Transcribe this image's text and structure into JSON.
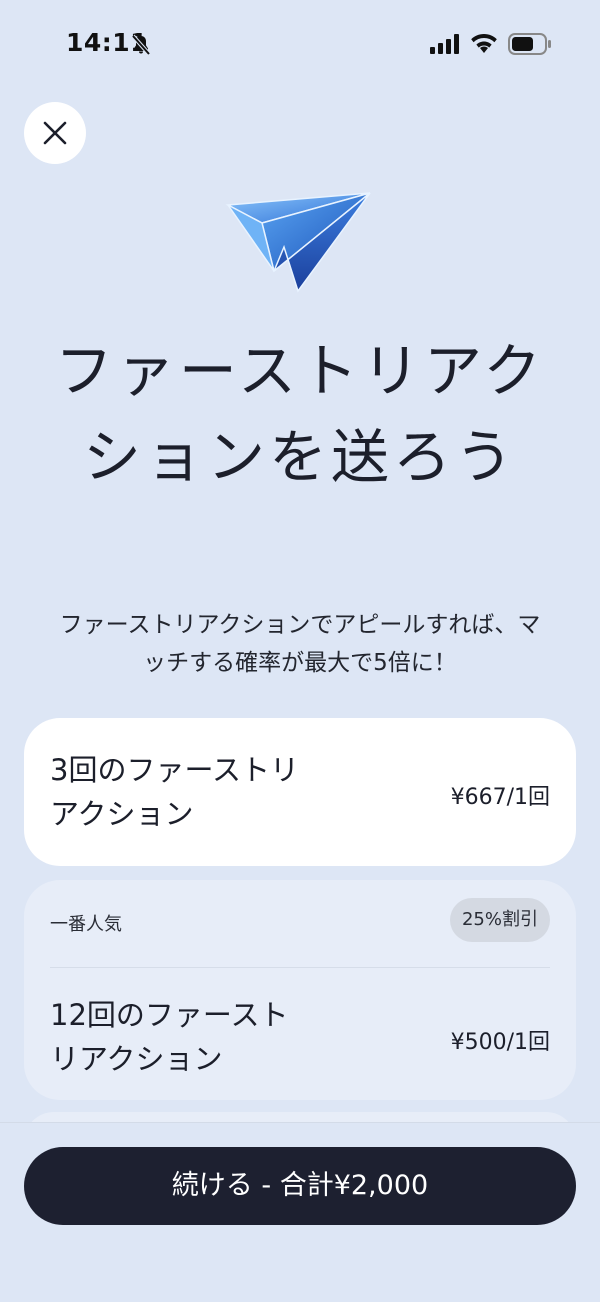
{
  "status_bar": {
    "time": "14:11",
    "icons": [
      "bell-slash-icon",
      "cellular-signal-icon",
      "wifi-icon",
      "battery-icon"
    ]
  },
  "header": {
    "close_icon": "close-icon",
    "hero_icon": "paper-plane-icon"
  },
  "main": {
    "title": "ファーストリアクションを送ろう",
    "subtitle": "ファーストリアクションでアピールすれば、マッチする確率が最大で5倍に！"
  },
  "options": [
    {
      "name": "3回のファーストリアクション",
      "price": "¥667/1回",
      "selected": true
    },
    {
      "badge_left": "一番人気",
      "badge_right": "25%割引",
      "name": "12回のファーストリアクション",
      "price": "¥500/1回",
      "selected": false
    }
  ],
  "footer": {
    "continue_label": "続ける - 合計¥2,000"
  },
  "colors": {
    "background": "#dde6f5",
    "selected_card": "#ffffff",
    "unselected_card": "#e7edf8",
    "button": "#1d2030",
    "button_text": "#ffffff",
    "plane_blue": "#3f8fe0"
  }
}
